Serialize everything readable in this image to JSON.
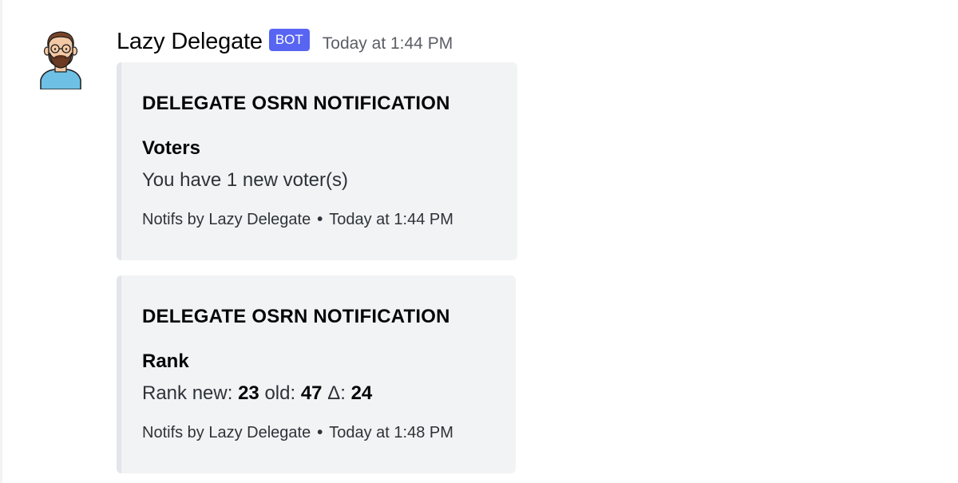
{
  "message": {
    "author": "Lazy Delegate",
    "bot_tag": "BOT",
    "timestamp": "Today at 1:44 PM",
    "avatar_icon": "bearded-man-avatar-icon"
  },
  "embeds": [
    {
      "title": "DELEGATE OSRN NOTIFICATION",
      "field_name": "Voters",
      "field_value": "You have 1 new voter(s)",
      "footer_text": "Notifs by Lazy Delegate",
      "footer_separator": "•",
      "footer_time": "Today at 1:44 PM"
    },
    {
      "title": "DELEGATE OSRN NOTIFICATION",
      "field_name": "Rank",
      "rank": {
        "new_label": "Rank new:",
        "new_value": "23",
        "old_label": "old:",
        "old_value": "47",
        "delta_label": "Δ:",
        "delta_value": "24"
      },
      "footer_text": "Notifs by Lazy Delegate",
      "footer_separator": "•",
      "footer_time": "Today at 1:48 PM"
    }
  ],
  "colors": {
    "bot_tag": "#5865f2",
    "embed_bg": "#f2f3f5",
    "embed_border": "#e3e5e8",
    "avatar_shirt": "#6ec1e4",
    "avatar_beard": "#6b3a22"
  }
}
